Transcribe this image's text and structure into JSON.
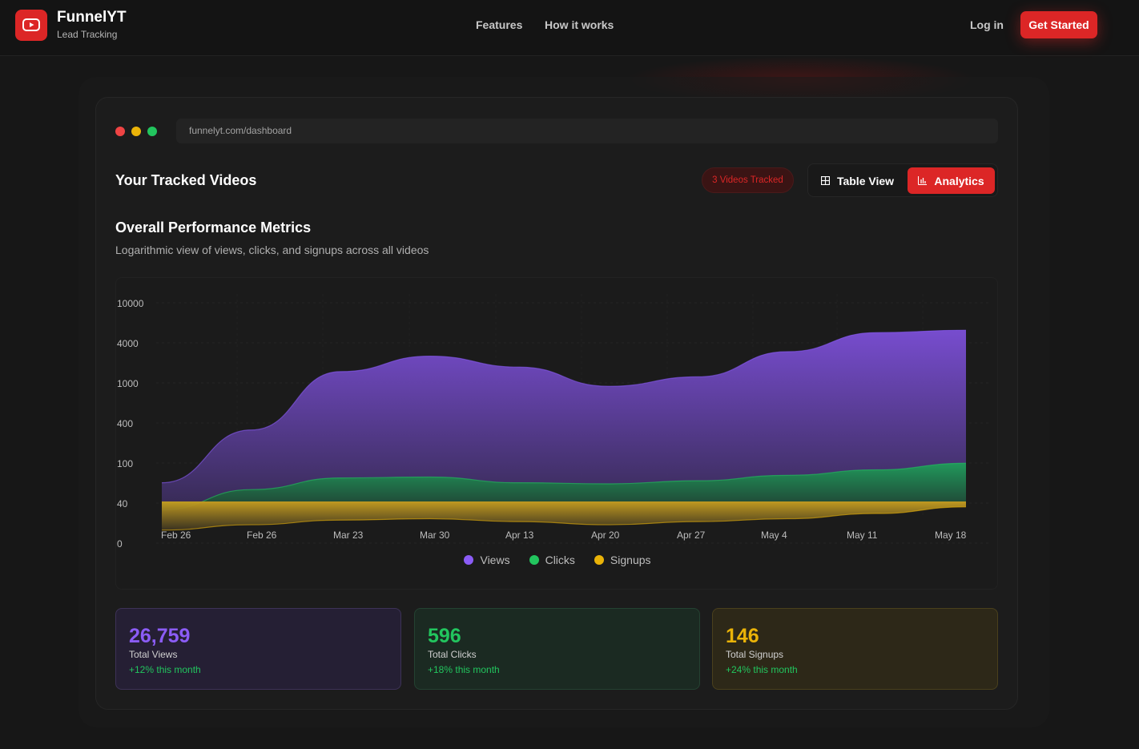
{
  "header": {
    "brand_name": "FunnelYT",
    "brand_sub": "Lead Tracking",
    "nav": [
      "Features",
      "How it works"
    ],
    "login": "Log in",
    "cta": "Get Started"
  },
  "browser": {
    "url": "funnelyt.com/dashboard"
  },
  "dashboard": {
    "title": "Your Tracked Videos",
    "badge": "3 Videos Tracked",
    "tabs": {
      "table": "Table View",
      "analytics": "Analytics"
    },
    "active_tab": "Analytics",
    "metrics_title": "Overall Performance Metrics",
    "metrics_subtitle": "Logarithmic view of views, clicks, and signups across all videos"
  },
  "chart_data": {
    "type": "area",
    "title": "",
    "xlabel": "",
    "ylabel": "",
    "y_scale": "log",
    "y_ticks": [
      "10000",
      "4000",
      "1000",
      "400",
      "100",
      "40",
      "0"
    ],
    "x_ticks": [
      "Feb 26",
      "Feb 26",
      "Mar 23",
      "Mar 30",
      "Apr 13",
      "Apr 20",
      "Apr 27",
      "May 4",
      "May 11",
      "May 18"
    ],
    "legend_position": "bottom",
    "grid": true,
    "series": [
      {
        "name": "Views",
        "color": "#8b5cf6",
        "values": [
          70,
          300,
          1500,
          2300,
          1700,
          1000,
          1300,
          2600,
          4400,
          4700
        ]
      },
      {
        "name": "Clicks",
        "color": "#22c55e",
        "values": [
          33,
          58,
          80,
          82,
          70,
          68,
          74,
          86,
          100,
          120
        ]
      },
      {
        "name": "Signups",
        "color": "#eab308",
        "values": [
          19,
          22,
          25,
          26,
          24,
          22,
          24,
          26,
          30,
          36
        ]
      }
    ]
  },
  "stats": [
    {
      "value": "26,759",
      "label": "Total Views",
      "change": "+12% this month",
      "color": "#8b5cf6"
    },
    {
      "value": "596",
      "label": "Total Clicks",
      "change": "+18% this month",
      "color": "#22c55e"
    },
    {
      "value": "146",
      "label": "Total Signups",
      "change": "+24% this month",
      "color": "#eab308"
    }
  ]
}
